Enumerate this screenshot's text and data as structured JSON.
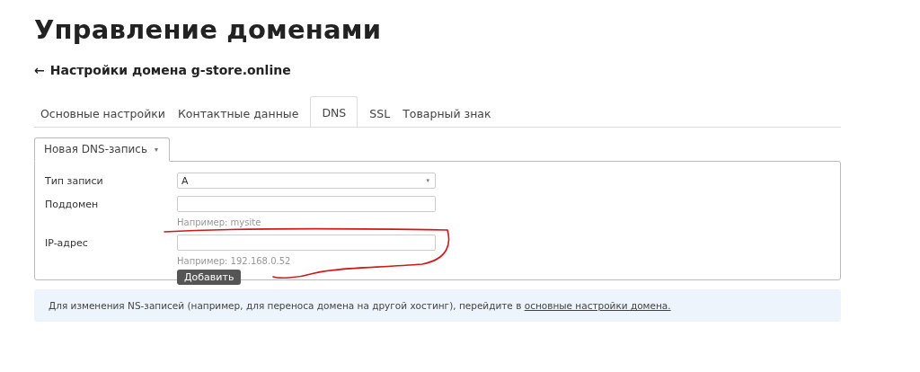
{
  "page_title": "Управление доменами",
  "back_link": {
    "arrow": "←",
    "label": "Настройки домена g-store.online"
  },
  "tabs": [
    {
      "label": "Основные настройки",
      "selected": false
    },
    {
      "label": "Контактные данные",
      "selected": false
    },
    {
      "label": "DNS",
      "selected": true
    },
    {
      "label": "SSL",
      "selected": false
    },
    {
      "label": "Товарный знак",
      "selected": false
    }
  ],
  "subtab": {
    "label": "Новая DNS-запись",
    "caret": "▾"
  },
  "form": {
    "fields": [
      {
        "kind": "select",
        "label": "Тип записи",
        "value": "A",
        "caret": "▾"
      },
      {
        "kind": "text",
        "label": "Поддомен",
        "hint": "Например: mysite"
      },
      {
        "kind": "text",
        "label": "IP-адрес",
        "hint": "Например: 192.168.0.52"
      }
    ],
    "submit": "Добавить"
  },
  "notice": {
    "text": "Для изменения NS-записей (например, для переноса домена на другой хостинг), перейдите в",
    "link": "основные настройки домена."
  }
}
